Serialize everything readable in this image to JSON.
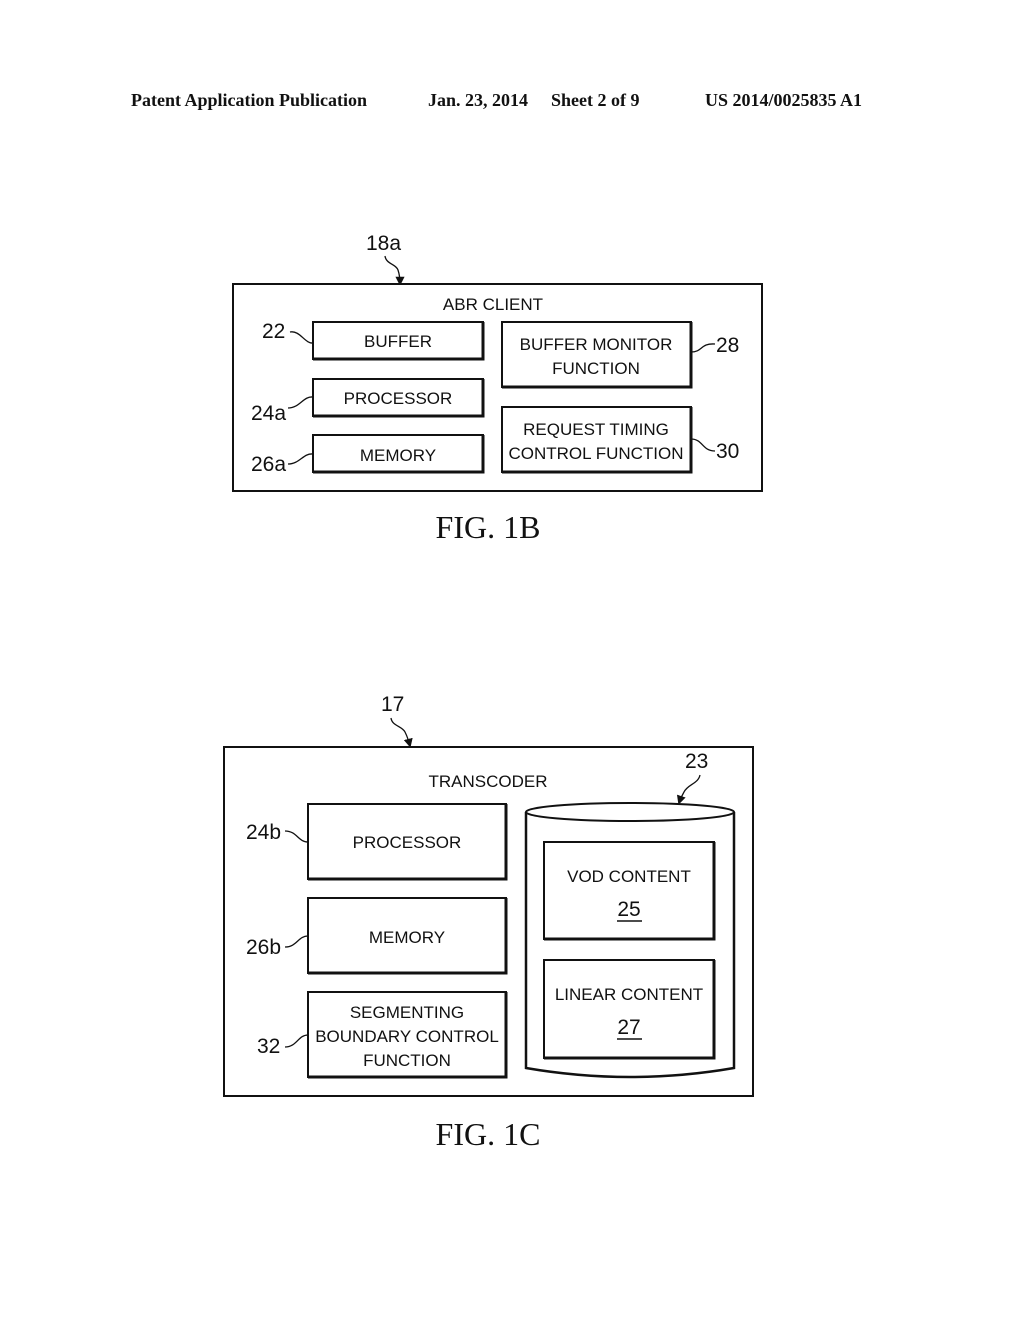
{
  "header": {
    "left": "Patent Application Publication",
    "date": "Jan. 23, 2014",
    "sheet": "Sheet 2 of 9",
    "number": "US 2014/0025835 A1"
  },
  "fig1b": {
    "ref": "18a",
    "title": "ABR CLIENT",
    "caption": "FIG. 1B",
    "buffer": {
      "label": "BUFFER",
      "ref": "22"
    },
    "processor": {
      "label": "PROCESSOR",
      "ref": "24a"
    },
    "memory": {
      "label": "MEMORY",
      "ref": "26a"
    },
    "monitor": {
      "line1": "BUFFER MONITOR",
      "line2": "FUNCTION",
      "ref": "28"
    },
    "timing": {
      "line1": "REQUEST TIMING",
      "line2": "CONTROL FUNCTION",
      "ref": "30"
    }
  },
  "fig1c": {
    "ref": "17",
    "title": "TRANSCODER",
    "caption": "FIG. 1C",
    "processor": {
      "label": "PROCESSOR",
      "ref": "24b"
    },
    "memory": {
      "label": "MEMORY",
      "ref": "26b"
    },
    "segmenting": {
      "line1": "SEGMENTING",
      "line2": "BOUNDARY CONTROL",
      "line3": "FUNCTION",
      "ref": "32"
    },
    "storage": {
      "ref": "23"
    },
    "vod": {
      "label": "VOD CONTENT",
      "ref": "25"
    },
    "linear": {
      "label": "LINEAR CONTENT",
      "ref": "27"
    }
  }
}
